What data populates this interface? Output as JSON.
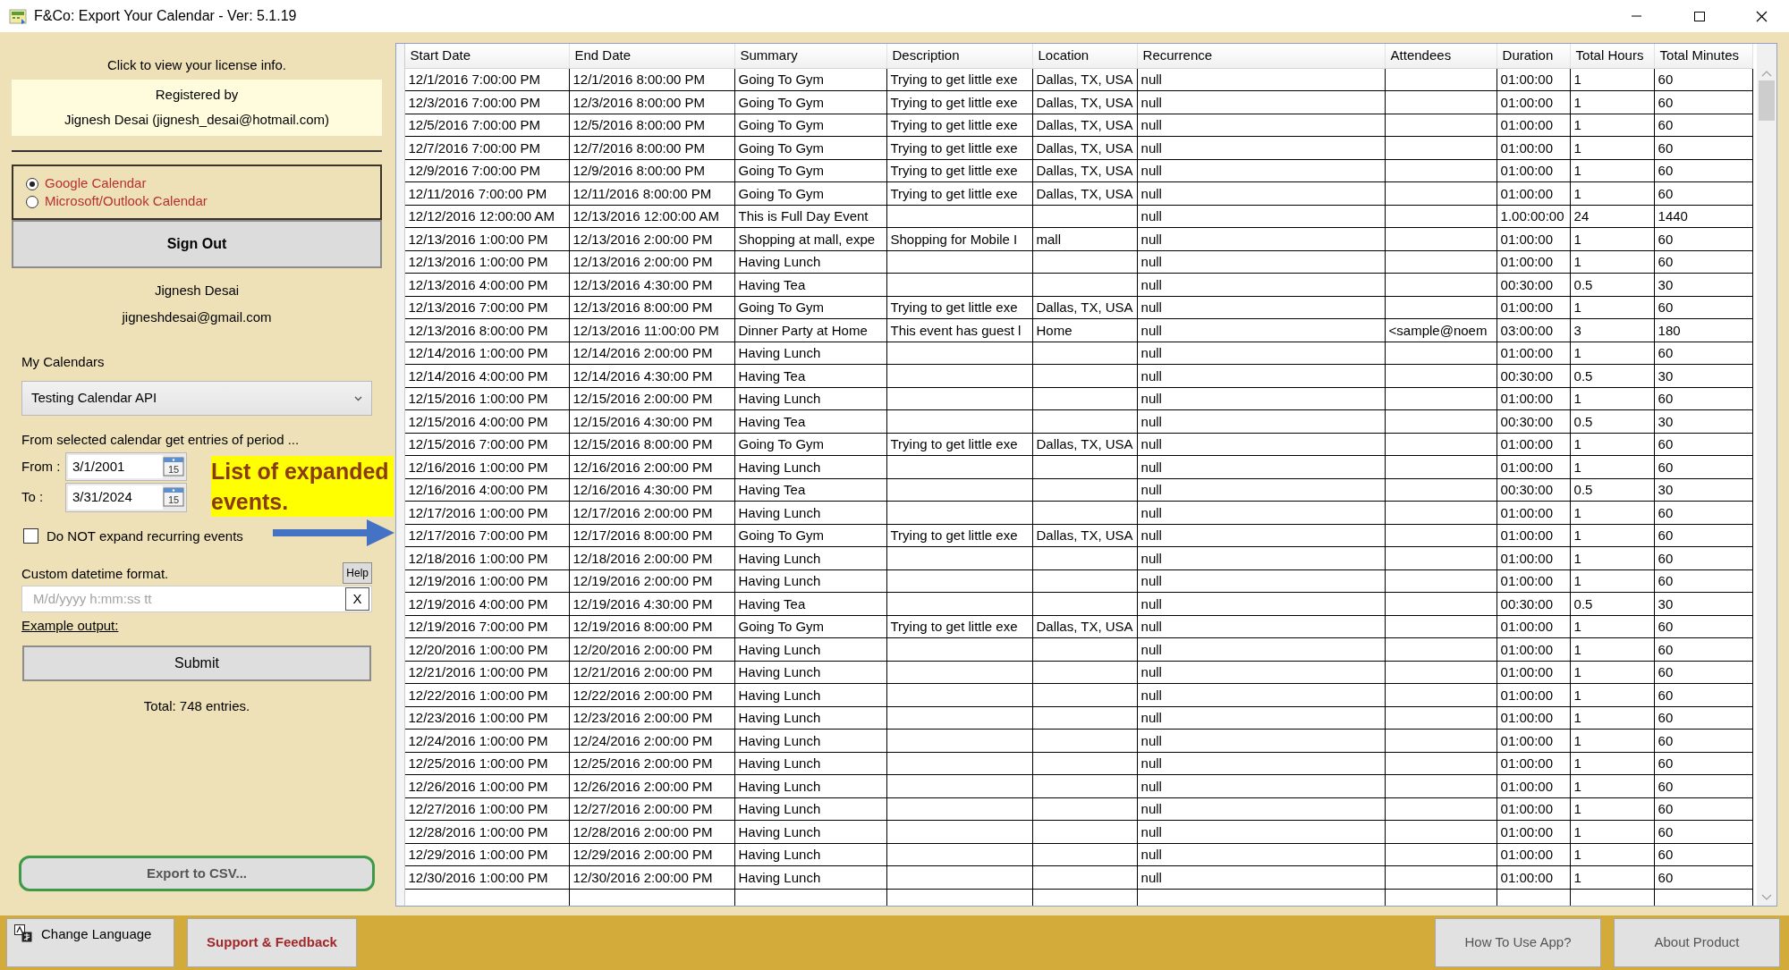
{
  "window": {
    "title": "F&Co: Export Your Calendar - Ver: 5.1.19"
  },
  "license": {
    "link": "Click to view your license info.",
    "registered_label": "Registered by",
    "registered_to": "Jignesh Desai (jignesh_desai@hotmail.com)"
  },
  "providers": [
    {
      "label": "Google Calendar",
      "selected": true
    },
    {
      "label": "Microsoft/Outlook Calendar",
      "selected": false
    }
  ],
  "sign_out": "Sign Out",
  "account": {
    "name": "Jignesh Desai",
    "email": "jigneshdesai@gmail.com"
  },
  "calendars": {
    "label": "My Calendars",
    "value": "Testing Calendar API"
  },
  "period": {
    "label": "From selected calendar get entries of period ...",
    "from_label": "From :",
    "from": "3/1/2001",
    "from_day": "15",
    "to_label": "To :",
    "to": "3/31/2024",
    "to_day": "15"
  },
  "no_expand": {
    "label": "Do NOT expand recurring events",
    "checked": false
  },
  "format": {
    "label": "Custom datetime format.",
    "help": "Help",
    "placeholder": "M/d/yyyy h:mm:ss tt",
    "clear": "X",
    "example": "Example output:"
  },
  "submit": "Submit",
  "total": "Total: 748 entries.",
  "export": "Export to CSV...",
  "callout": "List of expanded events.",
  "table": {
    "columns": [
      "Start Date",
      "End Date",
      "Summary",
      "Description",
      "Location",
      "Recurrence",
      "Attendees",
      "Duration",
      "Total Hours",
      "Total Minutes"
    ],
    "rows": [
      {
        "start": "12/1/2016 7:00:00 PM",
        "end": "12/1/2016 8:00:00 PM",
        "summary": "Going To Gym",
        "description": "Trying to get little exe",
        "location": "Dallas, TX, USA",
        "recurrence": "null",
        "duration": "01:00:00",
        "hours": "1",
        "minutes": "60"
      },
      {
        "start": "12/3/2016 7:00:00 PM",
        "end": "12/3/2016 8:00:00 PM",
        "summary": "Going To Gym",
        "description": "Trying to get little exe",
        "location": "Dallas, TX, USA",
        "recurrence": "null",
        "duration": "01:00:00",
        "hours": "1",
        "minutes": "60"
      },
      {
        "start": "12/5/2016 7:00:00 PM",
        "end": "12/5/2016 8:00:00 PM",
        "summary": "Going To Gym",
        "description": "Trying to get little exe",
        "location": "Dallas, TX, USA",
        "recurrence": "null",
        "duration": "01:00:00",
        "hours": "1",
        "minutes": "60"
      },
      {
        "start": "12/7/2016 7:00:00 PM",
        "end": "12/7/2016 8:00:00 PM",
        "summary": "Going To Gym",
        "description": "Trying to get little exe",
        "location": "Dallas, TX, USA",
        "recurrence": "null",
        "duration": "01:00:00",
        "hours": "1",
        "minutes": "60"
      },
      {
        "start": "12/9/2016 7:00:00 PM",
        "end": "12/9/2016 8:00:00 PM",
        "summary": "Going To Gym",
        "description": "Trying to get little exe",
        "location": "Dallas, TX, USA",
        "recurrence": "null",
        "duration": "01:00:00",
        "hours": "1",
        "minutes": "60"
      },
      {
        "start": "12/11/2016 7:00:00 PM",
        "end": "12/11/2016 8:00:00 PM",
        "summary": "Going To Gym",
        "description": "Trying to get little exe",
        "location": "Dallas, TX, USA",
        "recurrence": "null",
        "duration": "01:00:00",
        "hours": "1",
        "minutes": "60"
      },
      {
        "start": "12/12/2016 12:00:00 AM",
        "end": "12/13/2016 12:00:00 AM",
        "summary": "This is Full Day Event",
        "recurrence": "null",
        "duration": "1.00:00:00",
        "hours": "24",
        "minutes": "1440"
      },
      {
        "start": "12/13/2016 1:00:00 PM",
        "end": "12/13/2016 2:00:00 PM",
        "summary": "Shopping at mall, expe",
        "description": "Shopping for Mobile I",
        "location": "mall",
        "recurrence": "null",
        "duration": "01:00:00",
        "hours": "1",
        "minutes": "60"
      },
      {
        "start": "12/13/2016 1:00:00 PM",
        "end": "12/13/2016 2:00:00 PM",
        "summary": "Having Lunch",
        "recurrence": "null",
        "duration": "01:00:00",
        "hours": "1",
        "minutes": "60"
      },
      {
        "start": "12/13/2016 4:00:00 PM",
        "end": "12/13/2016 4:30:00 PM",
        "summary": "Having Tea",
        "recurrence": "null",
        "duration": "00:30:00",
        "hours": "0.5",
        "minutes": "30"
      },
      {
        "start": "12/13/2016 7:00:00 PM",
        "end": "12/13/2016 8:00:00 PM",
        "summary": "Going To Gym",
        "description": "Trying to get little exe",
        "location": "Dallas, TX, USA",
        "recurrence": "null",
        "duration": "01:00:00",
        "hours": "1",
        "minutes": "60"
      },
      {
        "start": "12/13/2016 8:00:00 PM",
        "end": "12/13/2016 11:00:00 PM",
        "summary": "Dinner Party at Home",
        "description": "This event has guest l",
        "location": "Home",
        "recurrence": "null",
        "attendees": "<sample@noem",
        "duration": "03:00:00",
        "hours": "3",
        "minutes": "180"
      },
      {
        "start": "12/14/2016 1:00:00 PM",
        "end": "12/14/2016 2:00:00 PM",
        "summary": "Having Lunch",
        "recurrence": "null",
        "duration": "01:00:00",
        "hours": "1",
        "minutes": "60"
      },
      {
        "start": "12/14/2016 4:00:00 PM",
        "end": "12/14/2016 4:30:00 PM",
        "summary": "Having Tea",
        "recurrence": "null",
        "duration": "00:30:00",
        "hours": "0.5",
        "minutes": "30"
      },
      {
        "start": "12/15/2016 1:00:00 PM",
        "end": "12/15/2016 2:00:00 PM",
        "summary": "Having Lunch",
        "recurrence": "null",
        "duration": "01:00:00",
        "hours": "1",
        "minutes": "60"
      },
      {
        "start": "12/15/2016 4:00:00 PM",
        "end": "12/15/2016 4:30:00 PM",
        "summary": "Having Tea",
        "recurrence": "null",
        "duration": "00:30:00",
        "hours": "0.5",
        "minutes": "30"
      },
      {
        "start": "12/15/2016 7:00:00 PM",
        "end": "12/15/2016 8:00:00 PM",
        "summary": "Going To Gym",
        "description": "Trying to get little exe",
        "location": "Dallas, TX, USA",
        "recurrence": "null",
        "duration": "01:00:00",
        "hours": "1",
        "minutes": "60"
      },
      {
        "start": "12/16/2016 1:00:00 PM",
        "end": "12/16/2016 2:00:00 PM",
        "summary": "Having Lunch",
        "recurrence": "null",
        "duration": "01:00:00",
        "hours": "1",
        "minutes": "60"
      },
      {
        "start": "12/16/2016 4:00:00 PM",
        "end": "12/16/2016 4:30:00 PM",
        "summary": "Having Tea",
        "recurrence": "null",
        "duration": "00:30:00",
        "hours": "0.5",
        "minutes": "30"
      },
      {
        "start": "12/17/2016 1:00:00 PM",
        "end": "12/17/2016 2:00:00 PM",
        "summary": "Having Lunch",
        "recurrence": "null",
        "duration": "01:00:00",
        "hours": "1",
        "minutes": "60"
      },
      {
        "start": "12/17/2016 7:00:00 PM",
        "end": "12/17/2016 8:00:00 PM",
        "summary": "Going To Gym",
        "description": "Trying to get little exe",
        "location": "Dallas, TX, USA",
        "recurrence": "null",
        "duration": "01:00:00",
        "hours": "1",
        "minutes": "60"
      },
      {
        "start": "12/18/2016 1:00:00 PM",
        "end": "12/18/2016 2:00:00 PM",
        "summary": "Having Lunch",
        "recurrence": "null",
        "duration": "01:00:00",
        "hours": "1",
        "minutes": "60"
      },
      {
        "start": "12/19/2016 1:00:00 PM",
        "end": "12/19/2016 2:00:00 PM",
        "summary": "Having Lunch",
        "recurrence": "null",
        "duration": "01:00:00",
        "hours": "1",
        "minutes": "60"
      },
      {
        "start": "12/19/2016 4:00:00 PM",
        "end": "12/19/2016 4:30:00 PM",
        "summary": "Having Tea",
        "recurrence": "null",
        "duration": "00:30:00",
        "hours": "0.5",
        "minutes": "30"
      },
      {
        "start": "12/19/2016 7:00:00 PM",
        "end": "12/19/2016 8:00:00 PM",
        "summary": "Going To Gym",
        "description": "Trying to get little exe",
        "location": "Dallas, TX, USA",
        "recurrence": "null",
        "duration": "01:00:00",
        "hours": "1",
        "minutes": "60"
      },
      {
        "start": "12/20/2016 1:00:00 PM",
        "end": "12/20/2016 2:00:00 PM",
        "summary": "Having Lunch",
        "recurrence": "null",
        "duration": "01:00:00",
        "hours": "1",
        "minutes": "60"
      },
      {
        "start": "12/21/2016 1:00:00 PM",
        "end": "12/21/2016 2:00:00 PM",
        "summary": "Having Lunch",
        "recurrence": "null",
        "duration": "01:00:00",
        "hours": "1",
        "minutes": "60"
      },
      {
        "start": "12/22/2016 1:00:00 PM",
        "end": "12/22/2016 2:00:00 PM",
        "summary": "Having Lunch",
        "recurrence": "null",
        "duration": "01:00:00",
        "hours": "1",
        "minutes": "60"
      },
      {
        "start": "12/23/2016 1:00:00 PM",
        "end": "12/23/2016 2:00:00 PM",
        "summary": "Having Lunch",
        "recurrence": "null",
        "duration": "01:00:00",
        "hours": "1",
        "minutes": "60"
      },
      {
        "start": "12/24/2016 1:00:00 PM",
        "end": "12/24/2016 2:00:00 PM",
        "summary": "Having Lunch",
        "recurrence": "null",
        "duration": "01:00:00",
        "hours": "1",
        "minutes": "60"
      },
      {
        "start": "12/25/2016 1:00:00 PM",
        "end": "12/25/2016 2:00:00 PM",
        "summary": "Having Lunch",
        "recurrence": "null",
        "duration": "01:00:00",
        "hours": "1",
        "minutes": "60"
      },
      {
        "start": "12/26/2016 1:00:00 PM",
        "end": "12/26/2016 2:00:00 PM",
        "summary": "Having Lunch",
        "recurrence": "null",
        "duration": "01:00:00",
        "hours": "1",
        "minutes": "60"
      },
      {
        "start": "12/27/2016 1:00:00 PM",
        "end": "12/27/2016 2:00:00 PM",
        "summary": "Having Lunch",
        "recurrence": "null",
        "duration": "01:00:00",
        "hours": "1",
        "minutes": "60"
      },
      {
        "start": "12/28/2016 1:00:00 PM",
        "end": "12/28/2016 2:00:00 PM",
        "summary": "Having Lunch",
        "recurrence": "null",
        "duration": "01:00:00",
        "hours": "1",
        "minutes": "60"
      },
      {
        "start": "12/29/2016 1:00:00 PM",
        "end": "12/29/2016 2:00:00 PM",
        "summary": "Having Lunch",
        "recurrence": "null",
        "duration": "01:00:00",
        "hours": "1",
        "minutes": "60"
      },
      {
        "start": "12/30/2016 1:00:00 PM",
        "end": "12/30/2016 2:00:00 PM",
        "summary": "Having Lunch",
        "recurrence": "null",
        "duration": "01:00:00",
        "hours": "1",
        "minutes": "60"
      }
    ]
  },
  "footer": {
    "change_language": "Change Language",
    "support": "Support & Feedback",
    "how_to": "How To Use App?",
    "about": "About Product"
  }
}
